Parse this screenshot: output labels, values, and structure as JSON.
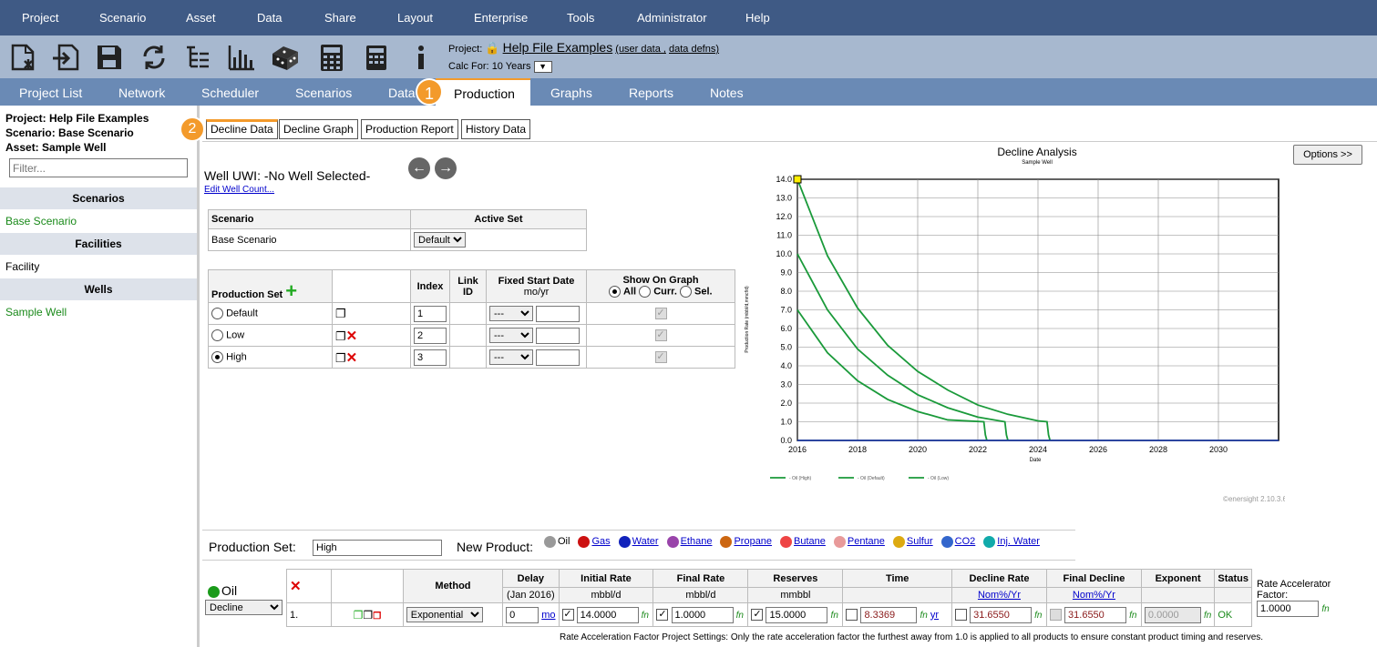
{
  "menu": [
    "Project",
    "Scenario",
    "Asset",
    "Data",
    "Share",
    "Layout",
    "Enterprise",
    "Tools",
    "Administrator",
    "Help"
  ],
  "toolbar": {
    "icons": [
      "new-file-icon",
      "import-icon",
      "save-icon",
      "refresh-icon",
      "tree-icon",
      "bar-chart-icon",
      "dice-icon",
      "calculator-icon",
      "calculator-alt-icon",
      "info-icon"
    ]
  },
  "project": {
    "label": "Project:",
    "name": "Help File Examples",
    "user_data": "(user data ,",
    "data_defns": "data defns)",
    "calc_label": "Calc For:",
    "calc_value": "10 Years"
  },
  "tabs": [
    "Project List",
    "Network",
    "Scheduler",
    "Scenarios",
    "Data",
    "Production",
    "Graphs",
    "Reports",
    "Notes"
  ],
  "badges": {
    "one": "1",
    "two": "2"
  },
  "sidebar": {
    "project": "Project: Help File Examples",
    "scenario": "Scenario: Base Scenario",
    "asset": "Asset: Sample Well",
    "filter_placeholder": "Filter...",
    "scen_header": "Scenarios",
    "scen_item": "Base Scenario",
    "fac_header": "Facilities",
    "fac_item": "Facility",
    "wells_header": "Wells",
    "well_item": "Sample Well"
  },
  "subtabs": [
    "Decline Data",
    "Decline Graph",
    "Production Report",
    "History Data"
  ],
  "well": {
    "uwi": "Well UWI: -No Well Selected-",
    "edit_count": "Edit Well Count..."
  },
  "scenario_table": {
    "col1": "Scenario",
    "col2": "Active Set",
    "row_name": "Base Scenario",
    "row_set": "Default"
  },
  "prodset_table": {
    "h_set": "Production Set",
    "h_index": "Index",
    "h_link": "Link ID",
    "h_fixed": "Fixed Start Date",
    "h_fixed2": "mo/yr",
    "h_show": "Show On Graph",
    "opt_all": "All",
    "opt_curr": "Curr.",
    "opt_sel": "Sel.",
    "date_sel": "---",
    "rows": [
      {
        "name": "Default",
        "index": "1"
      },
      {
        "name": "Low",
        "index": "2"
      },
      {
        "name": "High",
        "index": "3"
      }
    ]
  },
  "chart": {
    "options_button": "Options >>",
    "version": "©enersight 2.10.3.6"
  },
  "chart_data": {
    "type": "line",
    "title": "Decline Analysis",
    "subtitle": "Sample Well",
    "xlabel": "Date",
    "ylabel": "Production Rate (mbbl/d,mmcf/d)",
    "xlim": [
      2016,
      2032
    ],
    "ylim": [
      0,
      14
    ],
    "xticks": [
      "2016",
      "2018",
      "2020",
      "2022",
      "2024",
      "2026",
      "2028",
      "2030"
    ],
    "yticks": [
      "0.0",
      "1.0",
      "2.0",
      "3.0",
      "4.0",
      "5.0",
      "6.0",
      "7.0",
      "8.0",
      "9.0",
      "10.0",
      "11.0",
      "12.0",
      "13.0",
      "14.0"
    ],
    "series": [
      {
        "name": "- Oil (High)",
        "x": [
          2016,
          2017,
          2018,
          2019,
          2020,
          2021,
          2022,
          2023,
          2024,
          2024.3,
          2024.35,
          2024.4
        ],
        "y": [
          14.0,
          9.9,
          7.1,
          5.1,
          3.7,
          2.7,
          1.9,
          1.4,
          1.05,
          1.0,
          0.3,
          0
        ]
      },
      {
        "name": "- Oil (Default)",
        "x": [
          2016,
          2017,
          2018,
          2019,
          2020,
          2021,
          2022,
          2022.9,
          2022.95,
          2023.0
        ],
        "y": [
          10.0,
          7.0,
          4.9,
          3.5,
          2.45,
          1.75,
          1.25,
          1.0,
          0.3,
          0
        ]
      },
      {
        "name": "- Oil (Low)",
        "x": [
          2016,
          2017,
          2018,
          2019,
          2020,
          2021,
          2022.2,
          2022.25,
          2022.3
        ],
        "y": [
          7.0,
          4.7,
          3.2,
          2.2,
          1.55,
          1.1,
          1.0,
          0.3,
          0
        ]
      }
    ],
    "grid": true,
    "legend": "bottom"
  },
  "prod_set_bar": {
    "label": "Production Set:",
    "value": "High",
    "new_product": "New Product:",
    "products": [
      {
        "name": "Oil",
        "color": "#999999",
        "link": false
      },
      {
        "name": "Gas",
        "color": "#cc1111",
        "link": true
      },
      {
        "name": "Water",
        "color": "#1122bb",
        "link": true
      },
      {
        "name": "Ethane",
        "color": "#9944aa",
        "link": true
      },
      {
        "name": "Propane",
        "color": "#cc6611",
        "link": true
      },
      {
        "name": "Butane",
        "color": "#ee4444",
        "link": true
      },
      {
        "name": "Pentane",
        "color": "#e89a9a",
        "link": true
      },
      {
        "name": "Sulfur",
        "color": "#ddaa11",
        "link": true
      },
      {
        "name": "CO2",
        "color": "#3366cc",
        "link": true
      },
      {
        "name": "Inj. Water",
        "color": "#11aaaa",
        "link": true
      }
    ]
  },
  "oil": {
    "name": "Oil",
    "method_select": "Decline"
  },
  "decline_table": {
    "h_method": "Method",
    "h_delay": "Delay",
    "h_delay2": "(Jan 2016)",
    "h_initial": "Initial Rate",
    "h_initial2": "mbbl/d",
    "h_final": "Final Rate",
    "h_final2": "mbbl/d",
    "h_reserves": "Reserves",
    "h_reserves2": "mmbbl",
    "h_time": "Time",
    "h_decline": "Decline Rate",
    "h_decline2": "Nom%/Yr",
    "h_finaldec": "Final Decline",
    "h_finaldec2": "Nom%/Yr",
    "h_exponent": "Exponent",
    "h_status": "Status",
    "row": {
      "num": "1.",
      "method": "Exponential",
      "delay": "0",
      "delay_unit": "mo",
      "initial": "14.0000",
      "final": "1.0000",
      "reserves": "15.0000",
      "time": "8.3369",
      "time_unit": "yr",
      "decline": "31.6550",
      "final_decline": "31.6550",
      "exponent": "0.0000",
      "status": "OK",
      "fn": "fn"
    }
  },
  "rate_accel": {
    "label": "Rate Accelerator Factor:",
    "value": "1.0000",
    "note": "Rate Acceleration Factor Project Settings: Only the rate acceleration factor the furthest away from 1.0 is applied to all products to ensure constant product timing and reserves."
  }
}
